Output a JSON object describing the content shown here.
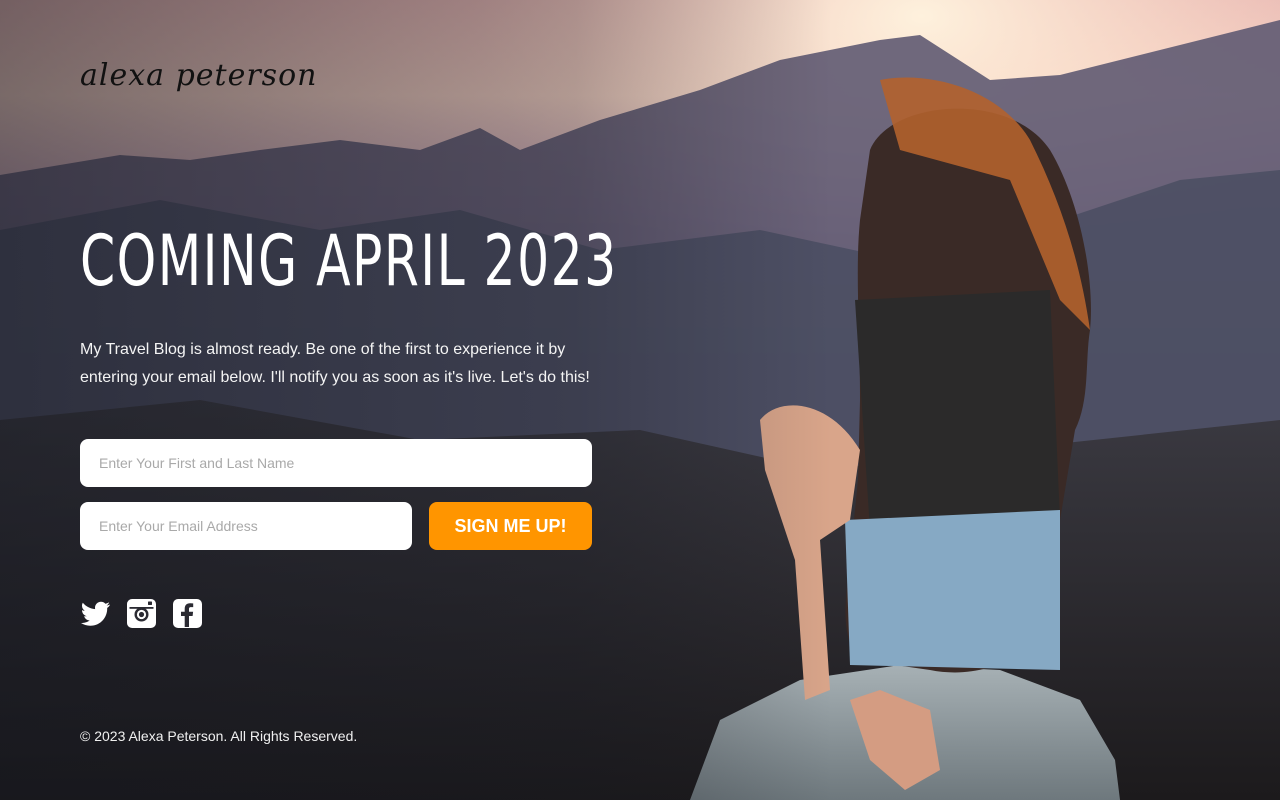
{
  "brand": {
    "logo_text": "alexa peterson"
  },
  "hero": {
    "headline": "COMING APRIL 2023",
    "intro": "My Travel Blog is almost ready. Be one of the first to experience it by entering your email below. I'll notify you as soon as it's live. Let's do this!"
  },
  "form": {
    "name_placeholder": "Enter Your First and Last Name",
    "email_placeholder": "Enter Your Email Address",
    "submit_label": "SIGN ME UP!"
  },
  "social": [
    {
      "name": "twitter-icon"
    },
    {
      "name": "instagram-icon"
    },
    {
      "name": "facebook-icon"
    }
  ],
  "footer": {
    "copyright": "© 2023 Alexa Peterson. All Rights Reserved."
  },
  "colors": {
    "accent": "#ff9500",
    "input_bg": "#ffffff",
    "logo": "#111111"
  }
}
